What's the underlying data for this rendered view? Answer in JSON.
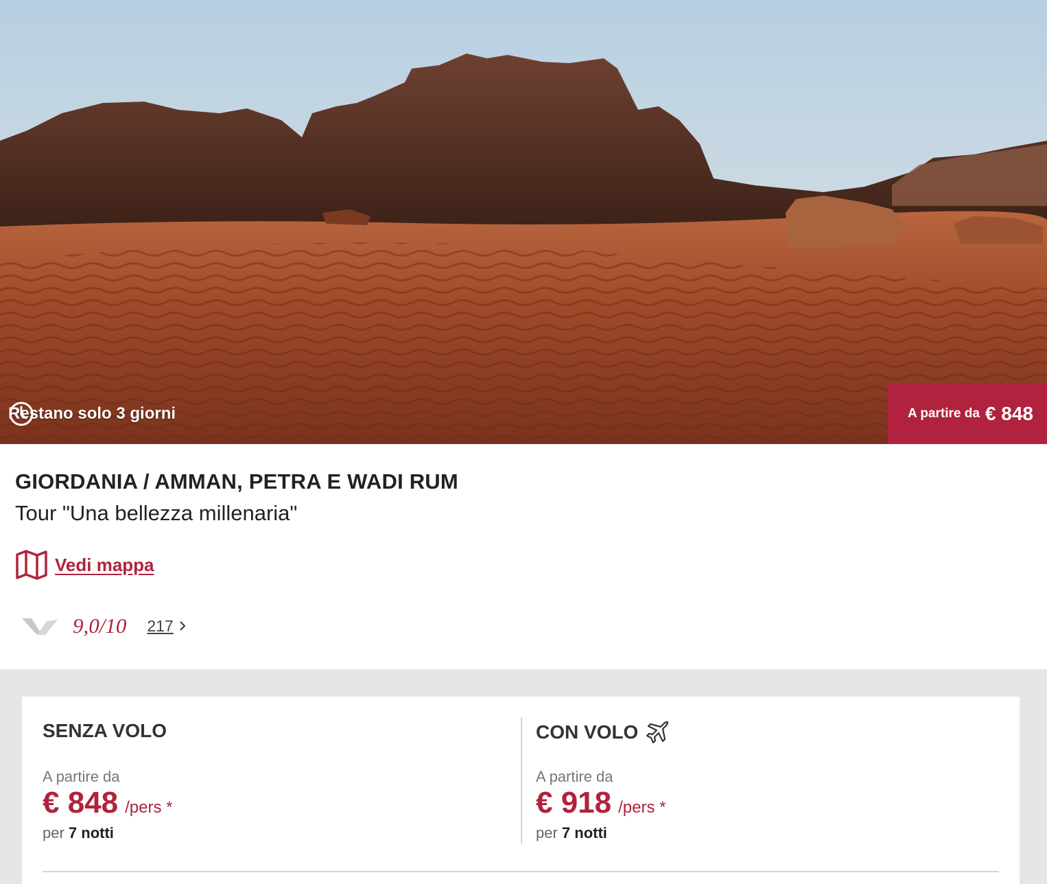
{
  "hero": {
    "countdown_icon": "clock-icon",
    "countdown_text": "Restano solo 3 giorni",
    "badge_label": "A partire da",
    "badge_price": "€ 848",
    "colors": {
      "badge": "#b0223d"
    }
  },
  "offer": {
    "title": "GIORDANIA / AMMAN, PETRA E WADI RUM",
    "subtitle": "Tour \"Una bellezza millenaria\"",
    "map_icon": "map-icon",
    "map_link": "Vedi mappa"
  },
  "rating": {
    "logo_icon": "brand-logo-icon",
    "score": "9,0/10",
    "reviews_count": "217"
  },
  "options": {
    "without_flight": {
      "title": "SENZA VOLO",
      "from_label": "A partire da",
      "price": "€ 848",
      "per_label": "/pers *",
      "nights_prefix": "per",
      "nights_value": "7 notti"
    },
    "with_flight": {
      "title": "CON VOLO",
      "icon": "airplane-icon",
      "from_label": "A partire da",
      "price": "€ 918",
      "per_label": "/pers *",
      "nights_prefix": "per",
      "nights_value": "7 notti"
    }
  },
  "colors": {
    "accent": "#b0223d",
    "text": "#222222",
    "muted": "#777777",
    "band": "#e6e6e6"
  }
}
